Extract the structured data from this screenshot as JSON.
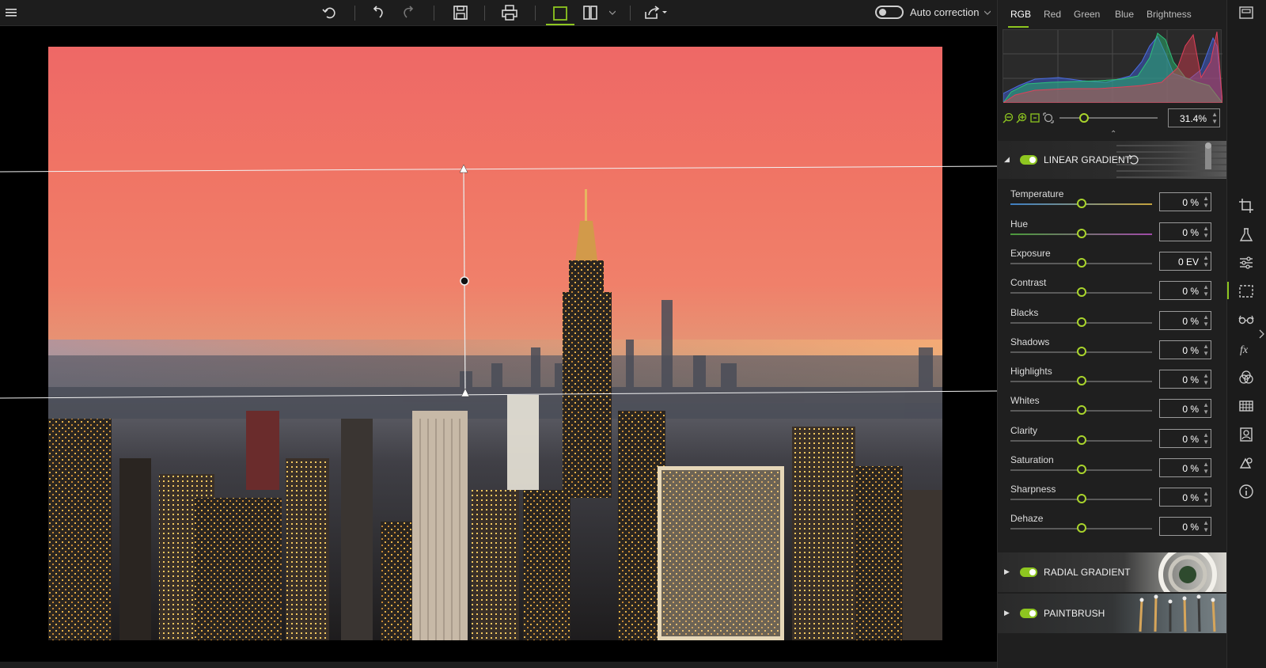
{
  "toolbar": {
    "auto_correction_label": "Auto correction",
    "auto_correction_on": false,
    "icons": [
      "menu-icon",
      "undo-history-icon",
      "undo-icon",
      "redo-icon",
      "save-icon",
      "print-icon",
      "single-view-icon",
      "split-view-icon",
      "share-icon"
    ]
  },
  "histogram": {
    "tabs": [
      "RGB",
      "Red",
      "Green",
      "Blue",
      "Brightness"
    ],
    "active_tab": "RGB"
  },
  "zoom": {
    "value": "31.4%",
    "icons": [
      "zoom-out-icon",
      "zoom-in-icon",
      "fit-icon",
      "actual-size-icon"
    ]
  },
  "linear_gradient": {
    "title": "LINEAR GRADIENT",
    "enabled": true,
    "sliders": [
      {
        "label": "Temperature",
        "value": "0 %"
      },
      {
        "label": "Hue",
        "value": "0 %"
      },
      {
        "label": "Exposure",
        "value": "0 EV"
      },
      {
        "label": "Contrast",
        "value": "0 %"
      },
      {
        "label": "Blacks",
        "value": "0 %"
      },
      {
        "label": "Shadows",
        "value": "0 %"
      },
      {
        "label": "Highlights",
        "value": "0 %"
      },
      {
        "label": "Whites",
        "value": "0 %"
      },
      {
        "label": "Clarity",
        "value": "0 %"
      },
      {
        "label": "Saturation",
        "value": "0 %"
      },
      {
        "label": "Sharpness",
        "value": "0 %"
      },
      {
        "label": "Dehaze",
        "value": "0 %"
      }
    ]
  },
  "radial_gradient": {
    "title": "RADIAL GRADIENT",
    "enabled": true
  },
  "paintbrush": {
    "title": "PAINTBRUSH",
    "enabled": true
  },
  "rail": {
    "icons": [
      "panel-toggle-icon",
      "crop-icon",
      "flask-icon",
      "adjustments-icon",
      "selection-icon",
      "glasses-icon",
      "fx-icon",
      "color-circles-icon",
      "grid-icon",
      "portrait-icon",
      "shapes-icon",
      "info-icon"
    ],
    "active": "selection-icon"
  },
  "colors": {
    "accent": "#8ec620",
    "panel_bg": "#1f1f1f",
    "toolbar_bg": "#1d1d1d"
  }
}
